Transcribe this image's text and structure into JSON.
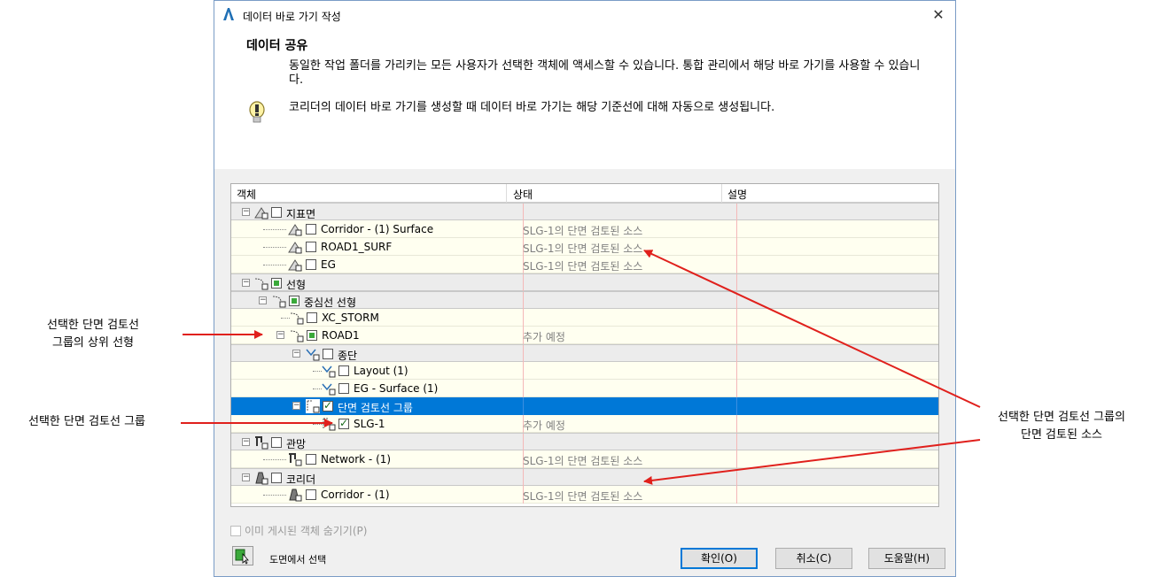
{
  "window": {
    "title": "데이터 바로 가기 작성",
    "close_glyph": "✕"
  },
  "header": {
    "section_title": "데이터 공유",
    "description": "동일한 작업 폴더를 가리키는 모든 사용자가 선택한 객체에 액세스할 수 있습니다. 통합 관리에서 해당 바로 가기를 사용할 수 있습니다.",
    "tip": "코리더의 데이터 바로 가기를 생성할 때 데이터 바로 가기는 해당 기준선에 대해 자동으로 생성됩니다."
  },
  "grid": {
    "columns": [
      "객체",
      "상태",
      "설명"
    ],
    "rows": [
      {
        "name": "지표면",
        "status": ""
      },
      {
        "name": "Corridor - (1) Surface",
        "status": "SLG-1의 단면 검토된 소스"
      },
      {
        "name": "ROAD1_SURF",
        "status": "SLG-1의 단면 검토된 소스"
      },
      {
        "name": "EG",
        "status": "SLG-1의 단면 검토된 소스"
      },
      {
        "name": "선형",
        "status": ""
      },
      {
        "name": "중심선 선형",
        "status": ""
      },
      {
        "name": "XC_STORM",
        "status": ""
      },
      {
        "name": "ROAD1",
        "status": "추가 예정"
      },
      {
        "name": "종단",
        "status": ""
      },
      {
        "name": "Layout (1)",
        "status": ""
      },
      {
        "name": "EG - Surface (1)",
        "status": ""
      },
      {
        "name": "단면 검토선 그룹",
        "status": ""
      },
      {
        "name": "SLG-1",
        "status": "추가 예정"
      },
      {
        "name": "관망",
        "status": ""
      },
      {
        "name": "Network - (1)",
        "status": "SLG-1의 단면 검토된 소스"
      },
      {
        "name": "코리더",
        "status": ""
      },
      {
        "name": "Corridor - (1)",
        "status": "SLG-1의 단면 검토된 소스"
      }
    ]
  },
  "footer": {
    "hide_published": "이미 게시된 객체 숨기기(P)",
    "pick_label": "도면에서 선택",
    "ok": "확인(O)",
    "cancel": "취소(C)",
    "help": "도움말(H)"
  },
  "callouts": {
    "parent_alignment": [
      "선택한 단면 검토선",
      "그룹의 상위 선형"
    ],
    "sample_line_group": "선택한 단면 검토선 그룹",
    "sampled_sources": [
      "선택한 단면 검토선 그룹의",
      "단면 검토된 소스"
    ]
  },
  "colors": {
    "selection": "#0078d7",
    "arrow": "#e0201c",
    "item_row": "#fffff0"
  }
}
